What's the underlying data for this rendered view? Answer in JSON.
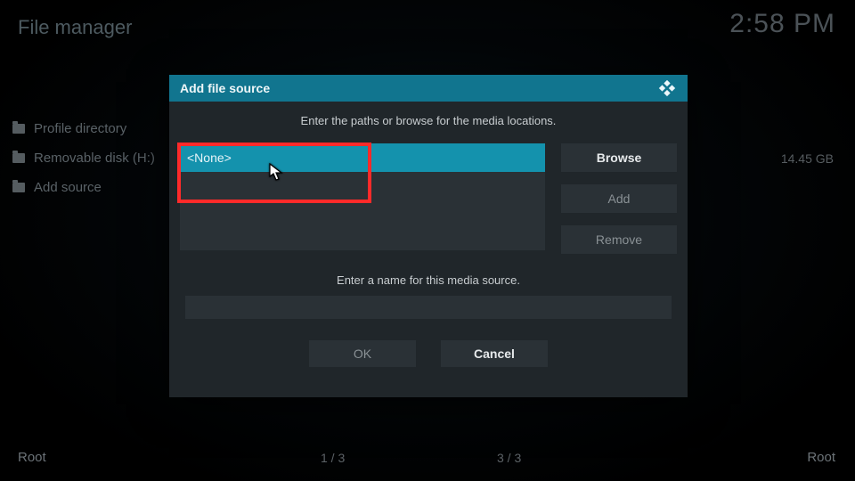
{
  "header": {
    "title": "File manager",
    "clock": "2:58 PM"
  },
  "sidebar": {
    "items": [
      {
        "label": "Profile directory"
      },
      {
        "label": "Removable disk (H:)",
        "size": "14.45 GB"
      },
      {
        "label": "Add source"
      }
    ]
  },
  "dialog": {
    "title": "Add file source",
    "prompt_paths": "Enter the paths or browse for the media locations.",
    "path_value": "<None>",
    "buttons": {
      "browse": "Browse",
      "add": "Add",
      "remove": "Remove"
    },
    "prompt_name": "Enter a name for this media source.",
    "name_value": "",
    "ok": "OK",
    "cancel": "Cancel"
  },
  "footer": {
    "left": "Root",
    "center1": "1 / 3",
    "center2": "3 / 3",
    "right": "Root"
  }
}
